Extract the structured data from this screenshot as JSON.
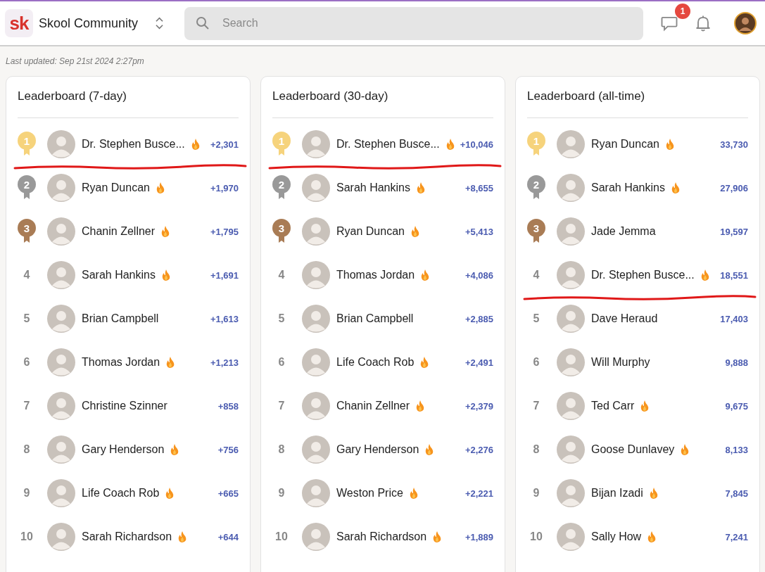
{
  "header": {
    "community_name": "Skool Community",
    "logo_text": "sk",
    "search": {
      "placeholder": "Search"
    },
    "chat_badge": "1"
  },
  "last_updated": "Last updated: Sep 21st 2024 2:27pm",
  "leaderboards": [
    {
      "title": "Leaderboard (7-day)",
      "entries": [
        {
          "rank": "1",
          "kind": "medal",
          "color": "#f6d37c",
          "name": "Dr. Stephen Busce...",
          "streak": true,
          "points": "+2,301",
          "underlined": true
        },
        {
          "rank": "2",
          "kind": "medal",
          "color": "#999999",
          "name": "Ryan Duncan",
          "streak": true,
          "points": "+1,970",
          "underlined": false
        },
        {
          "rank": "3",
          "kind": "medal",
          "color": "#a97c55",
          "name": "Chanin Zellner",
          "streak": true,
          "points": "+1,795",
          "underlined": false
        },
        {
          "rank": "4",
          "kind": "number",
          "name": "Sarah Hankins",
          "streak": true,
          "points": "+1,691",
          "underlined": false
        },
        {
          "rank": "5",
          "kind": "number",
          "name": "Brian Campbell",
          "streak": false,
          "points": "+1,613",
          "underlined": false
        },
        {
          "rank": "6",
          "kind": "number",
          "name": "Thomas Jordan",
          "streak": true,
          "points": "+1,213",
          "underlined": false
        },
        {
          "rank": "7",
          "kind": "number",
          "name": "Christine Szinner",
          "streak": false,
          "points": "+858",
          "underlined": false
        },
        {
          "rank": "8",
          "kind": "number",
          "name": "Gary Henderson",
          "streak": true,
          "points": "+756",
          "underlined": false
        },
        {
          "rank": "9",
          "kind": "number",
          "name": "Life Coach Rob",
          "streak": true,
          "points": "+665",
          "underlined": false
        },
        {
          "rank": "10",
          "kind": "number",
          "name": "Sarah Richardson",
          "streak": true,
          "points": "+644",
          "underlined": false
        }
      ]
    },
    {
      "title": "Leaderboard (30-day)",
      "entries": [
        {
          "rank": "1",
          "kind": "medal",
          "color": "#f6d37c",
          "name": "Dr. Stephen Busce...",
          "streak": true,
          "points": "+10,046",
          "underlined": true
        },
        {
          "rank": "2",
          "kind": "medal",
          "color": "#999999",
          "name": "Sarah Hankins",
          "streak": true,
          "points": "+8,655",
          "underlined": false
        },
        {
          "rank": "3",
          "kind": "medal",
          "color": "#a97c55",
          "name": "Ryan Duncan",
          "streak": true,
          "points": "+5,413",
          "underlined": false
        },
        {
          "rank": "4",
          "kind": "number",
          "name": "Thomas Jordan",
          "streak": true,
          "points": "+4,086",
          "underlined": false
        },
        {
          "rank": "5",
          "kind": "number",
          "name": "Brian Campbell",
          "streak": false,
          "points": "+2,885",
          "underlined": false
        },
        {
          "rank": "6",
          "kind": "number",
          "name": "Life Coach Rob",
          "streak": true,
          "points": "+2,491",
          "underlined": false
        },
        {
          "rank": "7",
          "kind": "number",
          "name": "Chanin Zellner",
          "streak": true,
          "points": "+2,379",
          "underlined": false
        },
        {
          "rank": "8",
          "kind": "number",
          "name": "Gary Henderson",
          "streak": true,
          "points": "+2,276",
          "underlined": false
        },
        {
          "rank": "9",
          "kind": "number",
          "name": "Weston Price",
          "streak": true,
          "points": "+2,221",
          "underlined": false
        },
        {
          "rank": "10",
          "kind": "number",
          "name": "Sarah Richardson",
          "streak": true,
          "points": "+1,889",
          "underlined": false
        }
      ]
    },
    {
      "title": "Leaderboard (all-time)",
      "entries": [
        {
          "rank": "1",
          "kind": "medal",
          "color": "#f6d37c",
          "name": "Ryan Duncan",
          "streak": true,
          "points": "33,730",
          "underlined": false
        },
        {
          "rank": "2",
          "kind": "medal",
          "color": "#999999",
          "name": "Sarah Hankins",
          "streak": true,
          "points": "27,906",
          "underlined": false
        },
        {
          "rank": "3",
          "kind": "medal",
          "color": "#a97c55",
          "name": "Jade Jemma",
          "streak": false,
          "points": "19,597",
          "underlined": false
        },
        {
          "rank": "4",
          "kind": "number",
          "name": "Dr. Stephen Busce...",
          "streak": true,
          "points": "18,551",
          "underlined": true
        },
        {
          "rank": "5",
          "kind": "number",
          "name": "Dave Heraud",
          "streak": false,
          "points": "17,403",
          "underlined": false
        },
        {
          "rank": "6",
          "kind": "number",
          "name": "Will Murphy",
          "streak": false,
          "points": "9,888",
          "underlined": false
        },
        {
          "rank": "7",
          "kind": "number",
          "name": "Ted Carr",
          "streak": true,
          "points": "9,675",
          "underlined": false
        },
        {
          "rank": "8",
          "kind": "number",
          "name": "Goose Dunlavey",
          "streak": true,
          "points": "8,133",
          "underlined": false
        },
        {
          "rank": "9",
          "kind": "number",
          "name": "Bijan Izadi",
          "streak": true,
          "points": "7,845",
          "underlined": false
        },
        {
          "rank": "10",
          "kind": "number",
          "name": "Sally How",
          "streak": true,
          "points": "7,241",
          "underlined": false
        }
      ]
    }
  ]
}
